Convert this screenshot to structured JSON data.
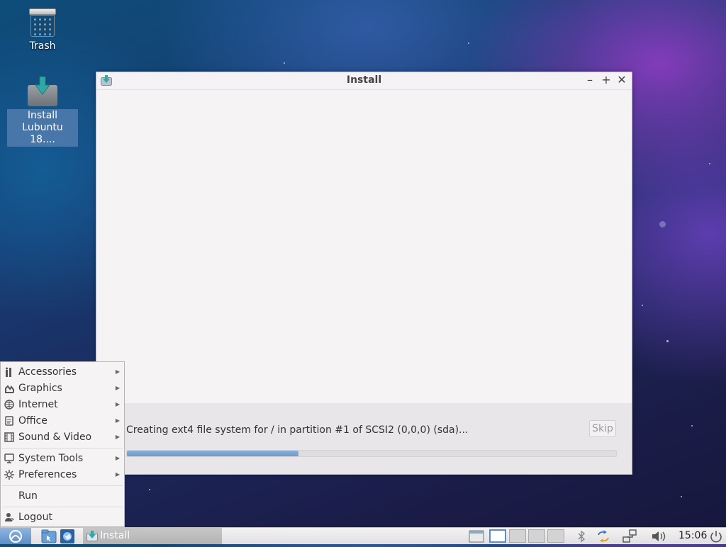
{
  "desktop": {
    "icons": [
      {
        "label": "Trash"
      },
      {
        "label": "Install\nLubuntu 18...."
      }
    ]
  },
  "window": {
    "title": "Install",
    "status_text": "Creating ext4 file system for / in partition #1 of SCSI2 (0,0,0) (sda)...",
    "skip_label": "Skip",
    "progress": 0.35
  },
  "menu": {
    "items": [
      {
        "label": "Accessories",
        "icon": "accessories-icon"
      },
      {
        "label": "Graphics",
        "icon": "graphics-icon"
      },
      {
        "label": "Internet",
        "icon": "internet-icon"
      },
      {
        "label": "Office",
        "icon": "office-icon"
      },
      {
        "label": "Sound & Video",
        "icon": "sound-video-icon"
      },
      {
        "label": "System Tools",
        "icon": "system-tools-icon"
      },
      {
        "label": "Preferences",
        "icon": "preferences-icon"
      },
      {
        "label": "Run",
        "icon": ""
      },
      {
        "label": "Logout",
        "icon": "logout-icon"
      }
    ]
  },
  "taskbar": {
    "task_label": "Install",
    "clock": "15:06"
  }
}
